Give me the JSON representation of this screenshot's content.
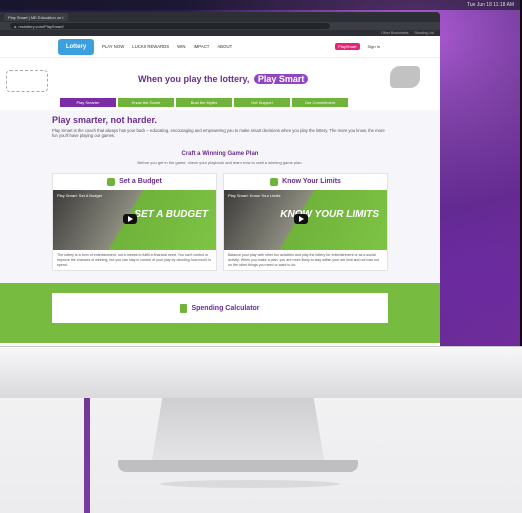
{
  "browser": {
    "tab_title": "Play Smart | ME Education on t",
    "url": "a. mslottery.com/PlaySmart/",
    "bookmarks": [
      "Other Bookmarks",
      "Reading List"
    ],
    "menubar_time": "Tue Jun 18 11:18 AM"
  },
  "site": {
    "logo_text": "Lottery",
    "nav": [
      "PLAY NOW",
      "LUCKII REWARDS",
      "WIN",
      "IMPACT",
      "ABOUT"
    ],
    "playsmart_pill": "PlaySmart",
    "sign_in": "Sign In"
  },
  "hero": {
    "title_prefix": "When you play the lottery,",
    "title_badge": "Play Smart"
  },
  "subnav": [
    "Play Smarter",
    "Know the Game",
    "Bust the Myths",
    "Get Support",
    "Our Commitment"
  ],
  "intro": {
    "heading": "Play smarter, not harder.",
    "text": "Play Smart is the coach that always has your back – educating, encouraging and empowering you to make smart decisions when you play the lottery. The more you know, the more fun you'll have playing our games."
  },
  "plan": {
    "title": "Craft a Winning Game Plan",
    "subtitle": "Before you get in the game, check your playbook and learn how to craft a winning game plan."
  },
  "cards": [
    {
      "title": "Set a Budget",
      "video_title": "Play Smart: Set A Budget",
      "video_overlay": "SET A BUDGET",
      "text": "The lottery is a form of entertainment, not a means to fulfill a financial need. You can't control or improve the chances of winning, but you can stay in control of your play by deciding how much to spend."
    },
    {
      "title": "Know Your Limits",
      "video_title": "Play Smart: Know Your Limits",
      "video_overlay": "KNOW YOUR LIMITS",
      "text": "Balance your play with other fun activities and play the lottery for entertainment or as a social activity. When you make a plan, you are more likely to stay within your set limit and not lose out on the other things you need or want to do."
    }
  ],
  "calculator": {
    "title": "Spending Calculator"
  }
}
